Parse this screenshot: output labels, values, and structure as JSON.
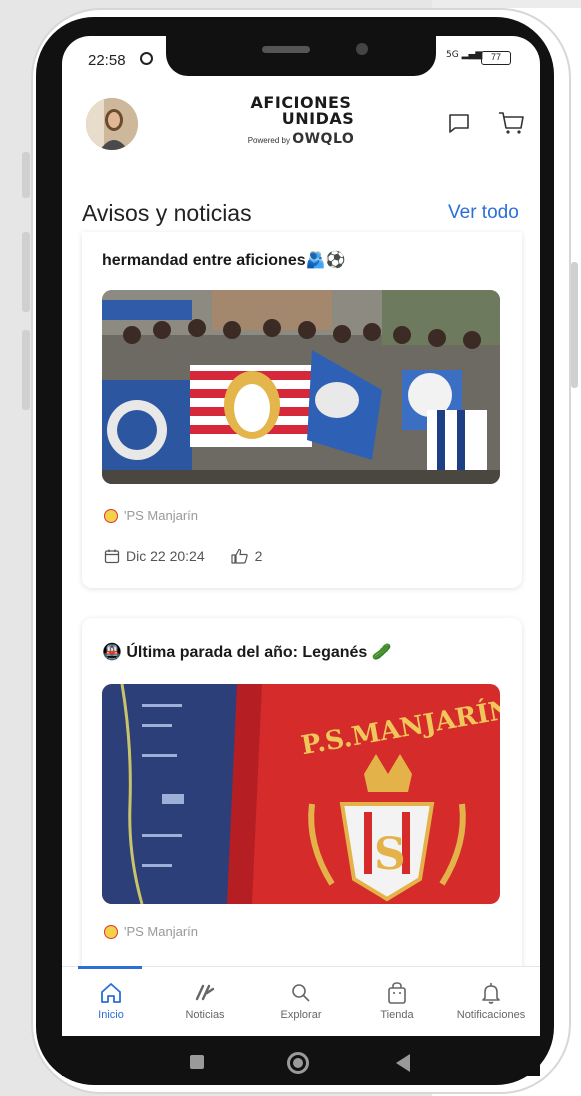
{
  "status": {
    "time": "22:58",
    "signal": "5G",
    "battery": "77"
  },
  "header": {
    "logo_line1": "AFICIONES",
    "logo_line2": "UNIDAS",
    "powered_by": "Powered by",
    "powered_brand": "OWQLO"
  },
  "section": {
    "title": "Avisos y noticias",
    "see_all": "Ver todo"
  },
  "posts": [
    {
      "title": "hermandad entre aficiones🫂⚽",
      "author": "'PS Manjarín",
      "date": "Dic 22 20:24",
      "likes": "2"
    },
    {
      "title": "🚇 Última parada del año: Leganés 🥒",
      "author": "'PS Manjarín"
    }
  ],
  "nav": [
    {
      "label": "Inicio",
      "icon": "home-icon",
      "active": true
    },
    {
      "label": "Noticias",
      "icon": "news-icon",
      "active": false
    },
    {
      "label": "Explorar",
      "icon": "search-icon",
      "active": false
    },
    {
      "label": "Tienda",
      "icon": "shop-bag-icon",
      "active": false
    },
    {
      "label": "Notificaciones",
      "icon": "bell-icon",
      "active": false
    }
  ],
  "colors": {
    "accent": "#2b6fd6",
    "text": "#222222",
    "muted": "#999999"
  }
}
